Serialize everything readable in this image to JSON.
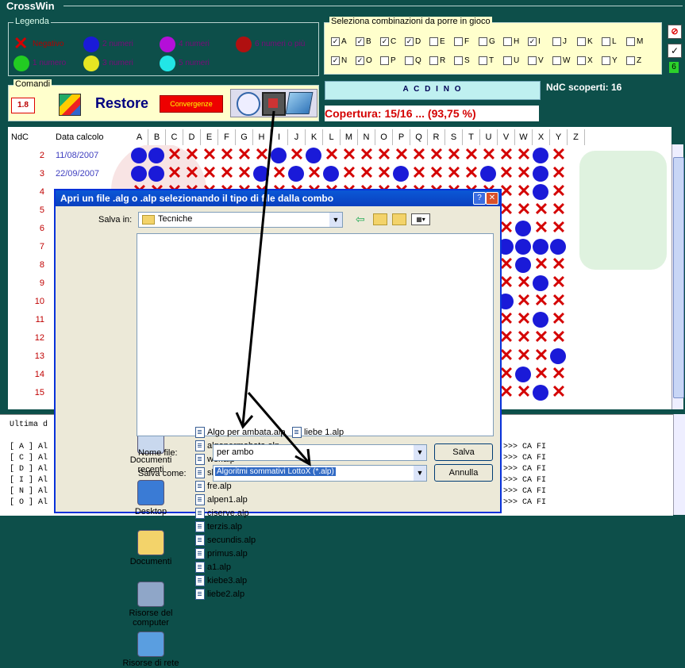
{
  "app": {
    "title": "CrossWin"
  },
  "legenda": {
    "title": "Legenda",
    "items": [
      {
        "label": "Negativo",
        "kind": "x",
        "color": "#d40000"
      },
      {
        "label": "2 numeri",
        "kind": "dot",
        "color": "#1a1ad8"
      },
      {
        "label": "4 numeri",
        "kind": "dot",
        "color": "#b40fd8"
      },
      {
        "label": "6 numeri o più",
        "kind": "dot",
        "color": "#b01010"
      },
      {
        "label": "1 numero",
        "kind": "dot",
        "color": "#22cc22"
      },
      {
        "label": "3 numeri",
        "kind": "dot",
        "color": "#e6e622"
      },
      {
        "label": "5 numeri",
        "kind": "dot",
        "color": "#22e6e6"
      }
    ]
  },
  "combinazioni": {
    "title": "Seleziona combinazioni da porre in gioco",
    "row1": [
      {
        "l": "A",
        "c": true
      },
      {
        "l": "B",
        "c": true
      },
      {
        "l": "C",
        "c": true
      },
      {
        "l": "D",
        "c": true
      },
      {
        "l": "E",
        "c": false
      },
      {
        "l": "F",
        "c": false
      },
      {
        "l": "G",
        "c": false
      },
      {
        "l": "H",
        "c": false
      },
      {
        "l": "I",
        "c": true
      },
      {
        "l": "J",
        "c": false
      },
      {
        "l": "K",
        "c": false
      },
      {
        "l": "L",
        "c": false
      },
      {
        "l": "M",
        "c": false
      }
    ],
    "row2": [
      {
        "l": "N",
        "c": true
      },
      {
        "l": "O",
        "c": true
      },
      {
        "l": "P",
        "c": false
      },
      {
        "l": "Q",
        "c": false
      },
      {
        "l": "R",
        "c": false
      },
      {
        "l": "S",
        "c": false
      },
      {
        "l": "T",
        "c": false
      },
      {
        "l": "U",
        "c": false
      },
      {
        "l": "V",
        "c": false
      },
      {
        "l": "W",
        "c": false
      },
      {
        "l": "X",
        "c": false
      },
      {
        "l": "Y",
        "c": false
      },
      {
        "l": "Z",
        "c": false
      }
    ],
    "counter": "6"
  },
  "comandi": {
    "title": "Comandi",
    "value": "1.8",
    "restore": "Restore",
    "convergenze": "Convergenze"
  },
  "status": {
    "combo_name": "A C D I N O",
    "ndc_scoperti": "NdC scoperti: 16",
    "copertura": "Copertura: 15/16 ... (93,75 %)"
  },
  "grid": {
    "header_ndc": "NdC",
    "header_data": "Data calcolo",
    "letters": [
      "A",
      "B",
      "C",
      "D",
      "E",
      "F",
      "G",
      "H",
      "I",
      "J",
      "K",
      "L",
      "M",
      "N",
      "O",
      "P",
      "Q",
      "R",
      "S",
      "T",
      "U",
      "V",
      "W",
      "X",
      "Y",
      "Z"
    ],
    "rows": [
      {
        "n": "2",
        "date": "11/08/2007",
        "cells": "OOXXXXXXOXOXXXXXXXXXXXXOX"
      },
      {
        "n": "3",
        "date": "22/09/2007",
        "cells": "OOXXXXXOXOXOXXXOXXXXOXXOX"
      },
      {
        "n": "4",
        "date": "",
        "cells": "XXXXXXXXXXXXXXXXXXXXXXXOX"
      },
      {
        "n": "5",
        "date": "",
        "cells": "XXXXXXXXXXXXXXXXXXXXXXXXX"
      },
      {
        "n": "6",
        "date": "",
        "cells": "XXXXXXXXXXXXXXXXXXXXXXOXX"
      },
      {
        "n": "7",
        "date": "",
        "cells": "XXXXXXXXXXXXXXXXXXXXXOOOO"
      },
      {
        "n": "8",
        "date": "",
        "cells": "XXXXXXXXXXXXXXXXXXXXXXOXX"
      },
      {
        "n": "9",
        "date": "",
        "cells": "XXXXXXXXXXXXXXXXXXXXXXXOX"
      },
      {
        "n": "10",
        "date": "",
        "cells": "XXXXXXXXXXXXXXXXXXXXXOXXX"
      },
      {
        "n": "11",
        "date": "",
        "cells": "XXXXXXXXXXXXXXXXXXXXXXXOX"
      },
      {
        "n": "12",
        "date": "",
        "cells": "XXXXXXXXXXXXXXXXXXXXXXXXX"
      },
      {
        "n": "13",
        "date": "",
        "cells": "XXXXXXXXXXXXXXXXXXXXXXXXO"
      },
      {
        "n": "14",
        "date": "",
        "cells": "XXXXXXXXXXXXXXXXXXXXXXOXX"
      },
      {
        "n": "15",
        "date": "",
        "cells": "XXXXXXXXXXXXXXXXXXXXXXXOX"
      }
    ]
  },
  "log": {
    "heading": "Ultima d",
    "lines": [
      {
        "left": "[ A ] Al",
        "right": ">>> CA FI"
      },
      {
        "left": "[ C ] Al",
        "right": ">>> CA FI"
      },
      {
        "left": "[ D ] Al",
        "right": ">>> CA FI"
      },
      {
        "left": "[ I ] Al",
        "right": ">>> CA FI"
      },
      {
        "left": "[ N ] Al",
        "right": ">>> CA FI"
      },
      {
        "left": "[ O ] Al",
        "right": ">>> CA FI"
      }
    ]
  },
  "dialog": {
    "title": "Apri un file .alg o .alp selezionando il tipo di file dalla combo",
    "save_in_label": "Salva in:",
    "folder": "Tecniche",
    "places": [
      "Documenti recenti",
      "Desktop",
      "Documenti",
      "Risorse del computer",
      "Risorse di rete"
    ],
    "files_col1": [
      "Algo per ambata.alp",
      "algopermabata.alp",
      "wer.alp",
      "slpensi.alp",
      "fre.alp",
      "alpen1.alp",
      "ciserve.alp",
      "terzis.alp",
      "secundis.alp",
      "primus.alp",
      "a1.alp",
      "kiebe3.alp",
      "liebe2.alp"
    ],
    "files_col2": [
      "liebe 1.alp"
    ],
    "filename_label": "Nome file:",
    "filename_value": "per ambo",
    "type_label": "Salva come:",
    "type_value": "Algoritmi sommativi LottoX (*.alp)",
    "save_button": "Salva",
    "cancel_button": "Annulla"
  }
}
